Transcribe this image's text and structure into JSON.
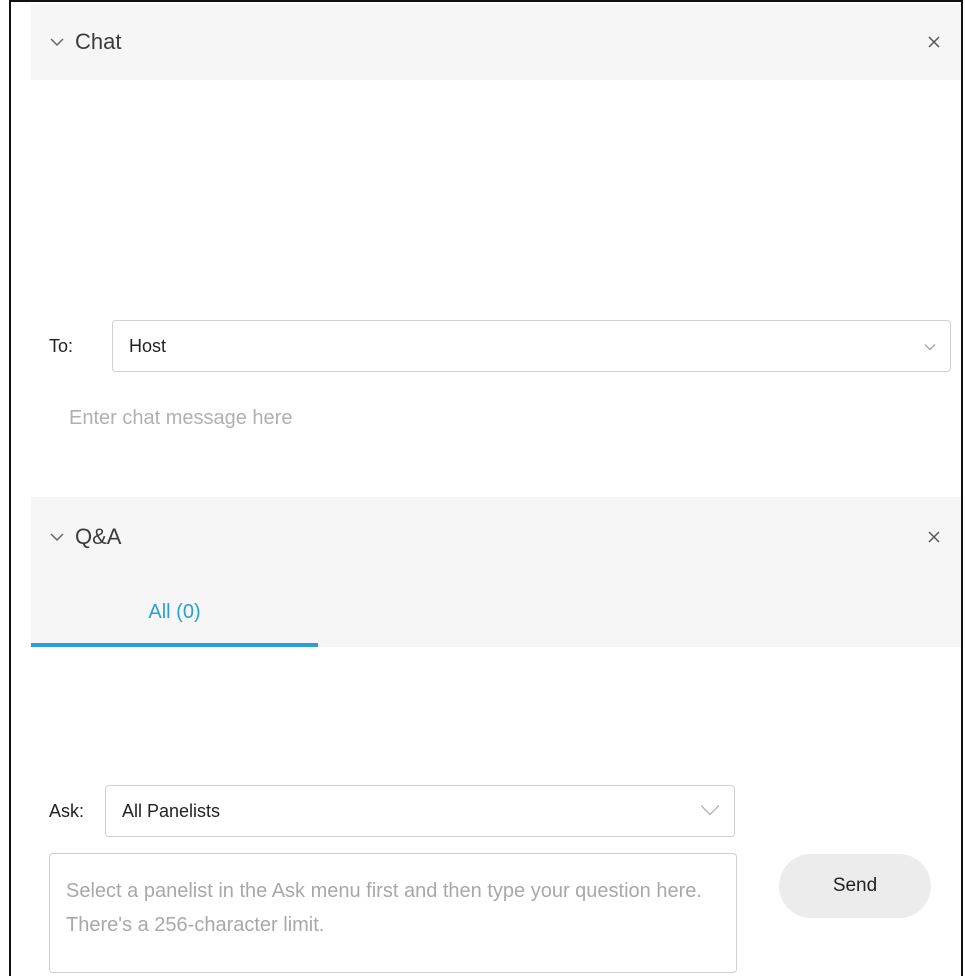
{
  "chat": {
    "title": "Chat",
    "to_label": "To:",
    "recipient": "Host",
    "message_placeholder": "Enter chat message here"
  },
  "qa": {
    "title": "Q&A",
    "tabs": [
      {
        "label": "All (0)"
      }
    ],
    "ask_label": "Ask:",
    "ask_target": "All Panelists",
    "question_placeholder": "Select a panelist in the Ask menu first and then type your question here. There's a 256-character limit.",
    "send_label": "Send"
  },
  "colors": {
    "accent": "#2a9fd8",
    "header_bg": "#f6f6f6",
    "border": "#d0d0d0"
  },
  "icons": {
    "collapse": "chevron-down-icon",
    "close": "close-icon",
    "dropdown": "chevron-down-icon"
  }
}
